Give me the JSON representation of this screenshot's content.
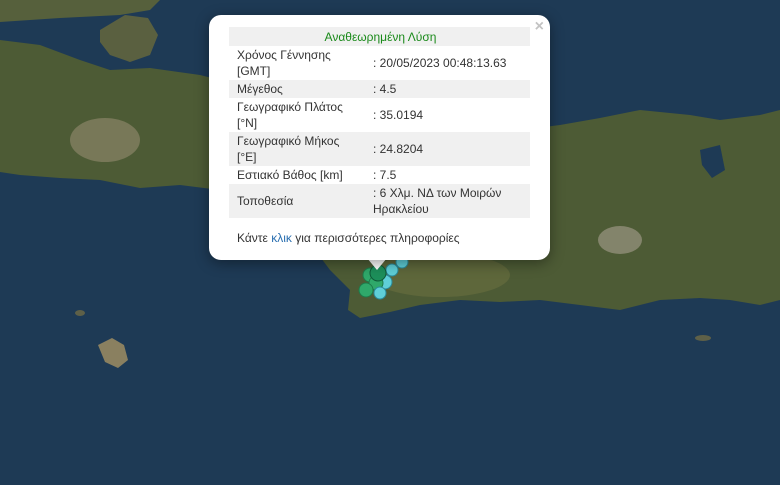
{
  "map": {
    "sea_color": "#1e3a55",
    "land_color": "#4f5e38",
    "marker_colors": [
      "#2fa86a",
      "#5fcfd8",
      "#1d8f5a"
    ]
  },
  "popup": {
    "title": "Αναθεωρημένη Λύση",
    "close_icon": "×",
    "rows": [
      {
        "label": "Χρόνος Γέννησης [GMT]",
        "value": ": 20/05/2023 00:48:13.63"
      },
      {
        "label": "Μέγεθος",
        "value": ": 4.5"
      },
      {
        "label": "Γεωγραφικό Πλάτος [°N]",
        "value": ": 35.0194"
      },
      {
        "label": "Γεωγραφικό Μήκος [°E]",
        "value": ": 24.8204"
      },
      {
        "label": "Εστιακό Βάθος [km]",
        "value": ": 7.5"
      },
      {
        "label": "Τοποθεσία",
        "value": ": 6 Χλμ. ΝΔ των Μοιρών Ηρακλείου"
      }
    ],
    "more_prefix": "Κάντε",
    "more_link": "κλικ",
    "more_suffix": "για περισσότερες πληροφορίες"
  }
}
